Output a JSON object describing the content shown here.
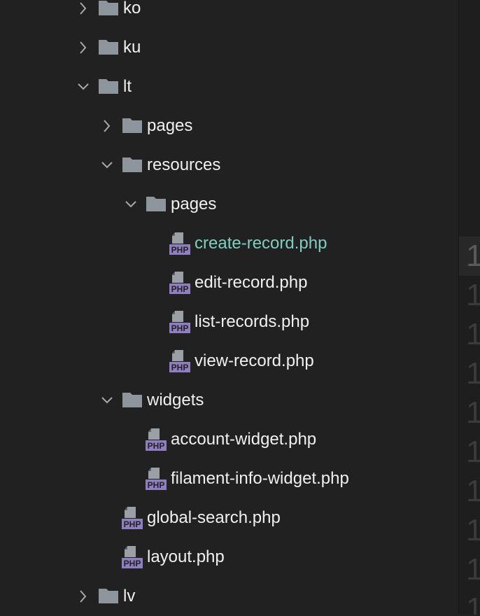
{
  "colors": {
    "background": "#212121",
    "text": "#f0f0f0",
    "active_text": "#7ecfc0",
    "folder": "#8e959d",
    "php_icon": "#8f7fc0"
  },
  "tree": {
    "rows": [
      {
        "label": "ko",
        "kind": "folder",
        "state": "collapsed",
        "depth": 0
      },
      {
        "label": "ku",
        "kind": "folder",
        "state": "collapsed",
        "depth": 0
      },
      {
        "label": "lt",
        "kind": "folder",
        "state": "expanded",
        "depth": 0
      },
      {
        "label": "pages",
        "kind": "folder",
        "state": "collapsed",
        "depth": 1
      },
      {
        "label": "resources",
        "kind": "folder",
        "state": "expanded",
        "depth": 1
      },
      {
        "label": "pages",
        "kind": "folder",
        "state": "expanded",
        "depth": 2
      },
      {
        "label": "create-record.php",
        "kind": "file",
        "icon": "php-file-icon",
        "depth": 3,
        "active": true
      },
      {
        "label": "edit-record.php",
        "kind": "file",
        "icon": "php-file-icon",
        "depth": 3
      },
      {
        "label": "list-records.php",
        "kind": "file",
        "icon": "php-file-icon",
        "depth": 3
      },
      {
        "label": "view-record.php",
        "kind": "file",
        "icon": "php-file-icon",
        "depth": 3
      },
      {
        "label": "widgets",
        "kind": "folder",
        "state": "expanded",
        "depth": 1
      },
      {
        "label": "account-widget.php",
        "kind": "file",
        "icon": "php-file-icon",
        "depth": 2
      },
      {
        "label": "filament-info-widget.php",
        "kind": "file",
        "icon": "php-file-icon",
        "depth": 2
      },
      {
        "label": "global-search.php",
        "kind": "file",
        "icon": "php-file-icon",
        "depth": 1
      },
      {
        "label": "layout.php",
        "kind": "file",
        "icon": "php-file-icon",
        "depth": 1
      },
      {
        "label": "lv",
        "kind": "folder",
        "state": "collapsed",
        "depth": 0
      }
    ]
  },
  "gutter": {
    "line_numbers": [
      "1",
      "1",
      "1",
      "1",
      "1",
      "1",
      "1",
      "1",
      "1",
      "1"
    ]
  }
}
